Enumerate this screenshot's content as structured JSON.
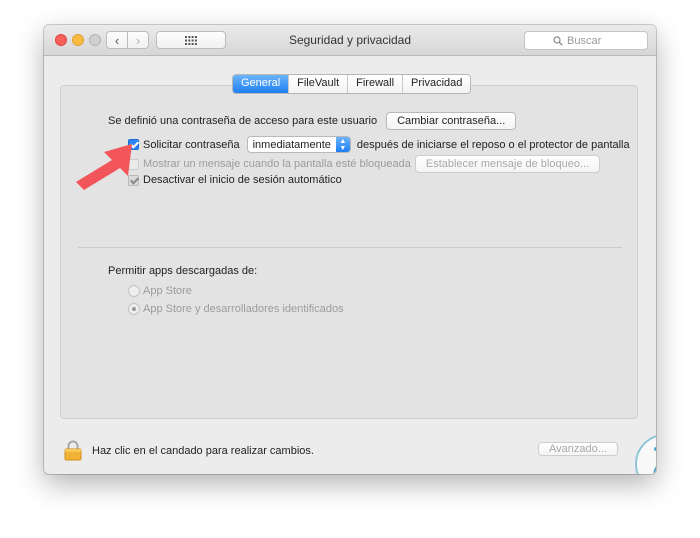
{
  "window": {
    "title": "Seguridad y privacidad",
    "search_placeholder": "Buscar"
  },
  "tabs": [
    {
      "label": "General",
      "active": true
    },
    {
      "label": "FileVault",
      "active": false
    },
    {
      "label": "Firewall",
      "active": false
    },
    {
      "label": "Privacidad",
      "active": false
    }
  ],
  "general": {
    "password_label": "Se definió una contraseña de acceso para este usuario",
    "change_password_button": "Cambiar contraseña...",
    "require_password": {
      "label": "Solicitar contraseña",
      "checked": true,
      "select_value": "inmediatamente",
      "suffix": "después de iniciarse el reposo o el protector de pantalla"
    },
    "lock_message": {
      "label": "Mostrar un mensaje cuando la pantalla esté bloqueada",
      "checked": false,
      "enabled": false,
      "button": "Establecer mensaje de bloqueo..."
    },
    "disable_autologin": {
      "label": "Desactivar el inicio de sesión automático",
      "checked": true
    },
    "allow_apps_label": "Permitir apps descargadas de:",
    "allow_apps_options": [
      {
        "label": "App Store",
        "selected": false
      },
      {
        "label": "App Store y desarrolladores identificados",
        "selected": true
      }
    ]
  },
  "footer": {
    "lock_text": "Haz clic en el candado para realizar cambios.",
    "advanced_button": "Avanzado..."
  },
  "colors": {
    "accent": "#1d7ff2",
    "arrow": "#f2555a",
    "watermark": "#4aa8c6"
  },
  "icons": {
    "lock": "lock-icon",
    "search": "search-icon",
    "arrow": "red-arrow-annotation"
  }
}
